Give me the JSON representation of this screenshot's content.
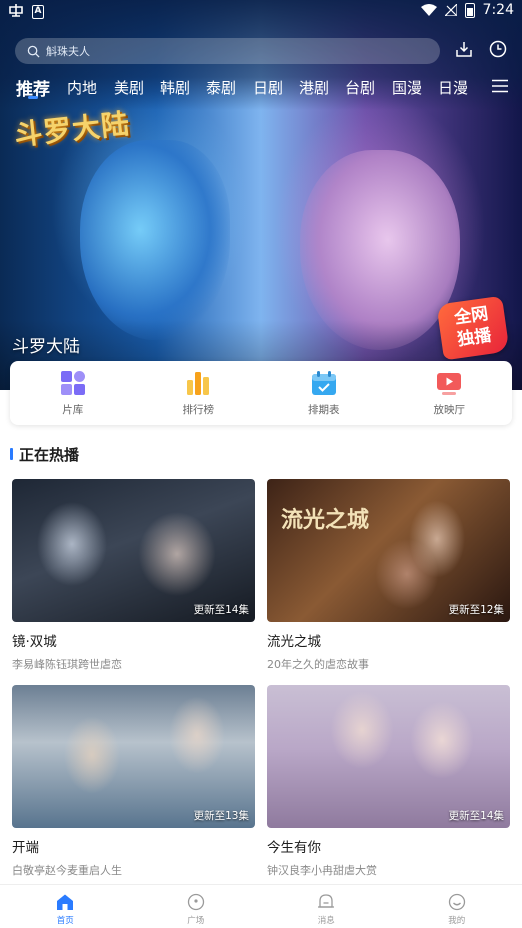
{
  "status_bar": {
    "time": "7:24",
    "battery_glyph": "Z"
  },
  "search": {
    "placeholder": "斛珠夫人"
  },
  "tabs": [
    {
      "label": "推荐",
      "active": true
    },
    {
      "label": "内地"
    },
    {
      "label": "美剧"
    },
    {
      "label": "韩剧"
    },
    {
      "label": "泰剧"
    },
    {
      "label": "日剧"
    },
    {
      "label": "港剧"
    },
    {
      "label": "台剧"
    },
    {
      "label": "国漫"
    },
    {
      "label": "日漫"
    }
  ],
  "banner": {
    "title": "斗罗大陆",
    "logo_text": "斗罗大陆",
    "badge_line1": "全网",
    "badge_line2": "独播"
  },
  "quick_nav": [
    {
      "label": "片库",
      "icon": "grid-icon",
      "color": "#7b6cf6"
    },
    {
      "label": "排行榜",
      "icon": "bar-chart-icon",
      "color": "#f7b32b"
    },
    {
      "label": "排期表",
      "icon": "calendar-icon",
      "color": "#35a8f0"
    },
    {
      "label": "放映厅",
      "icon": "play-screen-icon",
      "color": "#f25a5a"
    }
  ],
  "section": {
    "title": "正在热播"
  },
  "shows": [
    {
      "title": "镜·双城",
      "subtitle": "李易峰陈钰琪跨世虐恋",
      "update": "更新至14集"
    },
    {
      "title": "流光之城",
      "subtitle": "20年之久的虐恋故事",
      "update": "更新至12集",
      "poster_text": "流光之城"
    },
    {
      "title": "开端",
      "subtitle": "白敬亭赵今麦重启人生",
      "update": "更新至13集"
    },
    {
      "title": "今生有你",
      "subtitle": "钟汉良李小冉甜虐大赏",
      "update": "更新至14集"
    }
  ],
  "bottom_nav": [
    {
      "label": "首页",
      "icon": "home-icon",
      "active": true
    },
    {
      "label": "广场",
      "icon": "plaza-icon"
    },
    {
      "label": "消息",
      "icon": "message-icon"
    },
    {
      "label": "我的",
      "icon": "profile-icon"
    }
  ],
  "colors": {
    "accent": "#2a7bff",
    "header_bg": "#0b2e62"
  }
}
